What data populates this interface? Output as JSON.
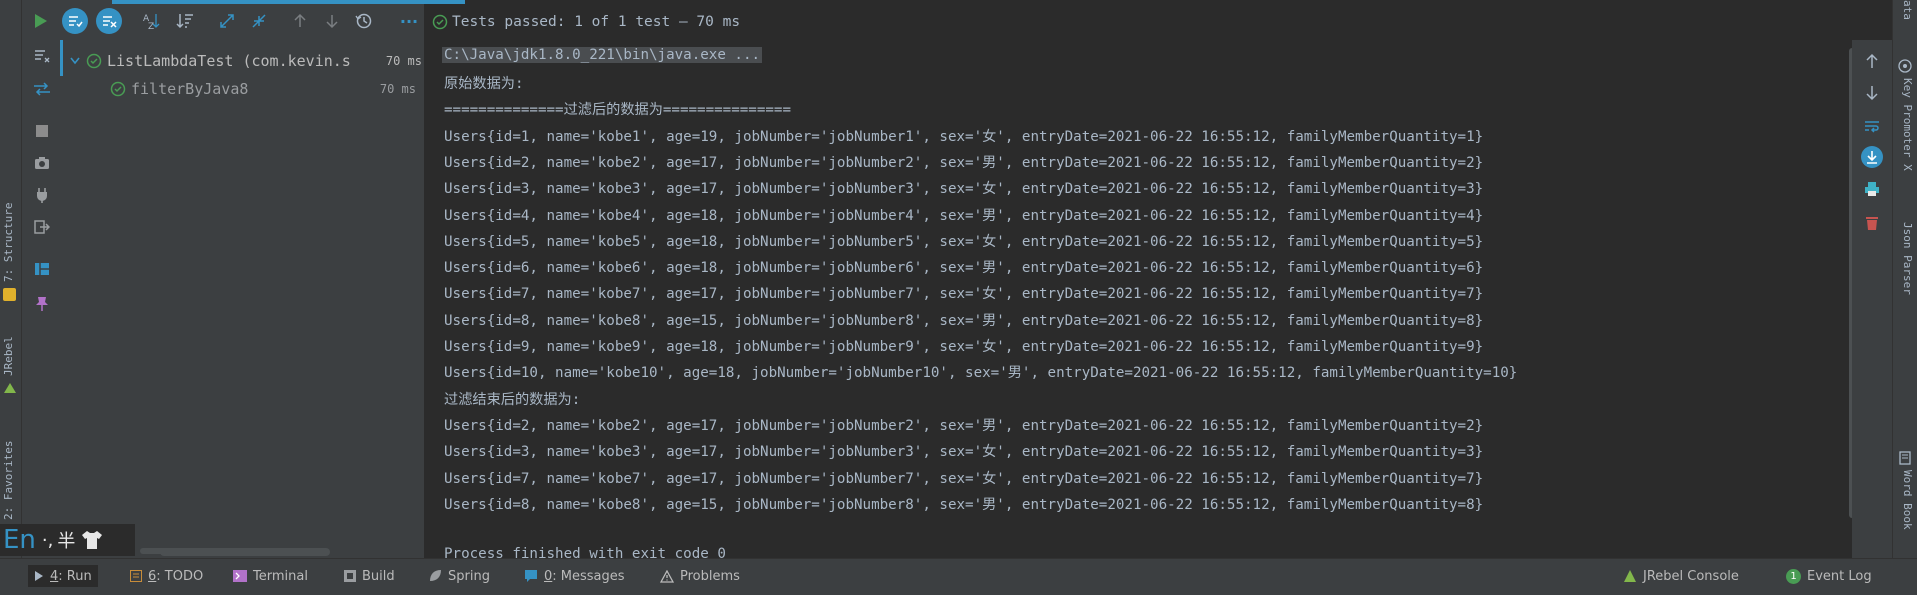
{
  "toolbar": {
    "test_status_text": "Tests passed: 1 of 1 test – 70 ms",
    "icons": [
      "run-icon",
      "show-passed-icon",
      "show-ignored-icon",
      "sort-alpha-icon",
      "sort-duration-icon",
      "expand-all-icon",
      "collapse-all-icon",
      "prev-failed-icon",
      "next-failed-icon",
      "history-icon",
      "more-icon"
    ]
  },
  "tree": {
    "items": [
      {
        "label": "ListLambdaTest (com.kevin.s",
        "duration": "70 ms",
        "status": "passed"
      },
      {
        "label": "filterByJava8",
        "duration": "70 ms",
        "status": "passed"
      }
    ]
  },
  "console": {
    "command": "C:\\Java\\jdk1.8.0_221\\bin\\java.exe ...",
    "lines": [
      "原始数据为:",
      "==============过滤后的数据为===============",
      "Users{id=1, name='kobe1', age=19, jobNumber='jobNumber1', sex='女', entryDate=2021-06-22 16:55:12, familyMemberQuantity=1}",
      "Users{id=2, name='kobe2', age=17, jobNumber='jobNumber2', sex='男', entryDate=2021-06-22 16:55:12, familyMemberQuantity=2}",
      "Users{id=3, name='kobe3', age=17, jobNumber='jobNumber3', sex='女', entryDate=2021-06-22 16:55:12, familyMemberQuantity=3}",
      "Users{id=4, name='kobe4', age=18, jobNumber='jobNumber4', sex='男', entryDate=2021-06-22 16:55:12, familyMemberQuantity=4}",
      "Users{id=5, name='kobe5', age=18, jobNumber='jobNumber5', sex='女', entryDate=2021-06-22 16:55:12, familyMemberQuantity=5}",
      "Users{id=6, name='kobe6', age=18, jobNumber='jobNumber6', sex='男', entryDate=2021-06-22 16:55:12, familyMemberQuantity=6}",
      "Users{id=7, name='kobe7', age=17, jobNumber='jobNumber7', sex='女', entryDate=2021-06-22 16:55:12, familyMemberQuantity=7}",
      "Users{id=8, name='kobe8', age=15, jobNumber='jobNumber8', sex='男', entryDate=2021-06-22 16:55:12, familyMemberQuantity=8}",
      "Users{id=9, name='kobe9', age=18, jobNumber='jobNumber9', sex='女', entryDate=2021-06-22 16:55:12, familyMemberQuantity=9}",
      "Users{id=10, name='kobe10', age=18, jobNumber='jobNumber10', sex='男', entryDate=2021-06-22 16:55:12, familyMemberQuantity=10}",
      "过滤结束后的数据为:",
      "Users{id=2, name='kobe2', age=17, jobNumber='jobNumber2', sex='男', entryDate=2021-06-22 16:55:12, familyMemberQuantity=2}",
      "Users{id=3, name='kobe3', age=17, jobNumber='jobNumber3', sex='女', entryDate=2021-06-22 16:55:12, familyMemberQuantity=3}",
      "Users{id=7, name='kobe7', age=17, jobNumber='jobNumber7', sex='女', entryDate=2021-06-22 16:55:12, familyMemberQuantity=7}",
      "Users{id=8, name='kobe8', age=15, jobNumber='jobNumber8', sex='男', entryDate=2021-06-22 16:55:12, familyMemberQuantity=8}",
      "",
      "Process finished with exit code 0"
    ]
  },
  "left_strip": {
    "labels": [
      "7: Structure",
      "JRebel",
      "2: Favorites"
    ]
  },
  "right_strip": {
    "labels": [
      "Key Promoter X",
      "Json Parser",
      "Word Book"
    ],
    "top_label": "ata"
  },
  "ime": {
    "lang": "En",
    "punct": "·,",
    "width": "半"
  },
  "statusbar": {
    "left": [
      {
        "num": "4",
        "label": ": Run",
        "icon": "run-icon"
      },
      {
        "num": "6",
        "label": ": TODO",
        "icon": "todo-icon"
      },
      {
        "num": "",
        "label": "Terminal",
        "icon": "terminal-icon"
      },
      {
        "num": "",
        "label": "Build",
        "icon": "build-icon"
      },
      {
        "num": "",
        "label": "Spring",
        "icon": "spring-icon"
      },
      {
        "num": "0",
        "label": ": Messages",
        "icon": "messages-icon"
      },
      {
        "num": "",
        "label": "Problems",
        "icon": "problems-icon"
      }
    ],
    "right": [
      {
        "label": "JRebel Console",
        "icon": "jrebel-icon"
      },
      {
        "label": "Event Log",
        "icon": "event-log-icon",
        "badge": "1"
      }
    ]
  },
  "colors": {
    "accent": "#3592c4",
    "pass_green": "#499c54",
    "console_text": "#a9b7c6",
    "panel_bg": "#3c3f41",
    "console_bg": "#2b2b2b"
  }
}
